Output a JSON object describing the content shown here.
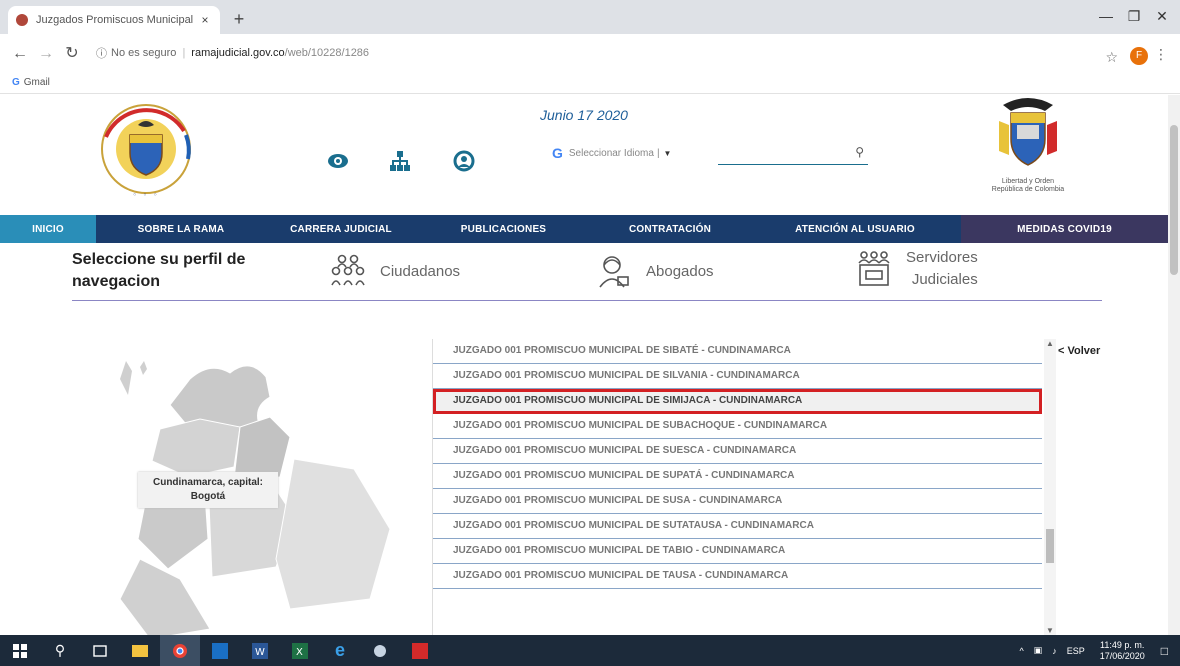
{
  "browser": {
    "tab_title": "Juzgados Promiscuos Municipal",
    "tab_close": "×",
    "new_tab": "+",
    "address": {
      "security_label": "No es seguro",
      "separator": "|",
      "domain": "ramajudicial.gov.co",
      "path": "/web/10228/1286"
    },
    "profile_initial": "F",
    "bookmarks": [
      {
        "label": "Gmail"
      }
    ]
  },
  "header": {
    "date": "Junio 17 2020",
    "translate_placeholder": "Seleccionar Idioma",
    "translate_separator": "|",
    "shield_caption_line1": "Libertad y Orden",
    "shield_caption_line2": "República de Colombia"
  },
  "nav": {
    "items": [
      {
        "label": "INICIO"
      },
      {
        "label": "SOBRE LA RAMA"
      },
      {
        "label": "CARRERA JUDICIAL"
      },
      {
        "label": "PUBLICACIONES"
      },
      {
        "label": "CONTRATACIÓN"
      },
      {
        "label": "ATENCIÓN AL USUARIO"
      },
      {
        "label": "MEDIDAS COVID19"
      }
    ]
  },
  "profile_select": {
    "label_line1": "Seleccione su perfil de",
    "label_line2": "navegacion",
    "options": [
      {
        "label": "Ciudadanos"
      },
      {
        "label": "Abogados"
      },
      {
        "label_line1": "Servidores",
        "label_line2": "Judiciales"
      }
    ]
  },
  "map": {
    "label_line1": "Cundinamarca, capital:",
    "label_line2": "Bogotá"
  },
  "courts": {
    "items": [
      {
        "name": "JUZGADO 001 PROMISCUO MUNICIPAL DE SIBATÉ - CUNDINAMARCA"
      },
      {
        "name": "JUZGADO 001 PROMISCUO MUNICIPAL DE SILVANIA - CUNDINAMARCA"
      },
      {
        "name": "JUZGADO 001 PROMISCUO MUNICIPAL DE SIMIJACA - CUNDINAMARCA"
      },
      {
        "name": "JUZGADO 001 PROMISCUO MUNICIPAL DE SUBACHOQUE - CUNDINAMARCA"
      },
      {
        "name": "JUZGADO 001 PROMISCUO MUNICIPAL DE SUESCA - CUNDINAMARCA"
      },
      {
        "name": "JUZGADO 001 PROMISCUO MUNICIPAL DE SUPATÁ - CUNDINAMARCA"
      },
      {
        "name": "JUZGADO 001 PROMISCUO MUNICIPAL DE SUSA - CUNDINAMARCA"
      },
      {
        "name": "JUZGADO 001 PROMISCUO MUNICIPAL DE SUTATAUSA - CUNDINAMARCA"
      },
      {
        "name": "JUZGADO 001 PROMISCUO MUNICIPAL DE TABIO - CUNDINAMARCA"
      },
      {
        "name": "JUZGADO 001 PROMISCUO MUNICIPAL DE TAUSA - CUNDINAMARCA"
      }
    ],
    "back_label": "< Volver"
  },
  "taskbar": {
    "language": "ESP",
    "time": "11:49 p. m.",
    "date": "17/06/2020"
  },
  "colors": {
    "nav_bg": "#1a3c6c",
    "nav_inicio": "#2a8eb8",
    "nav_covid": "#3b3760",
    "highlight_border": "#d32023",
    "date_text": "#1f5f9a"
  }
}
